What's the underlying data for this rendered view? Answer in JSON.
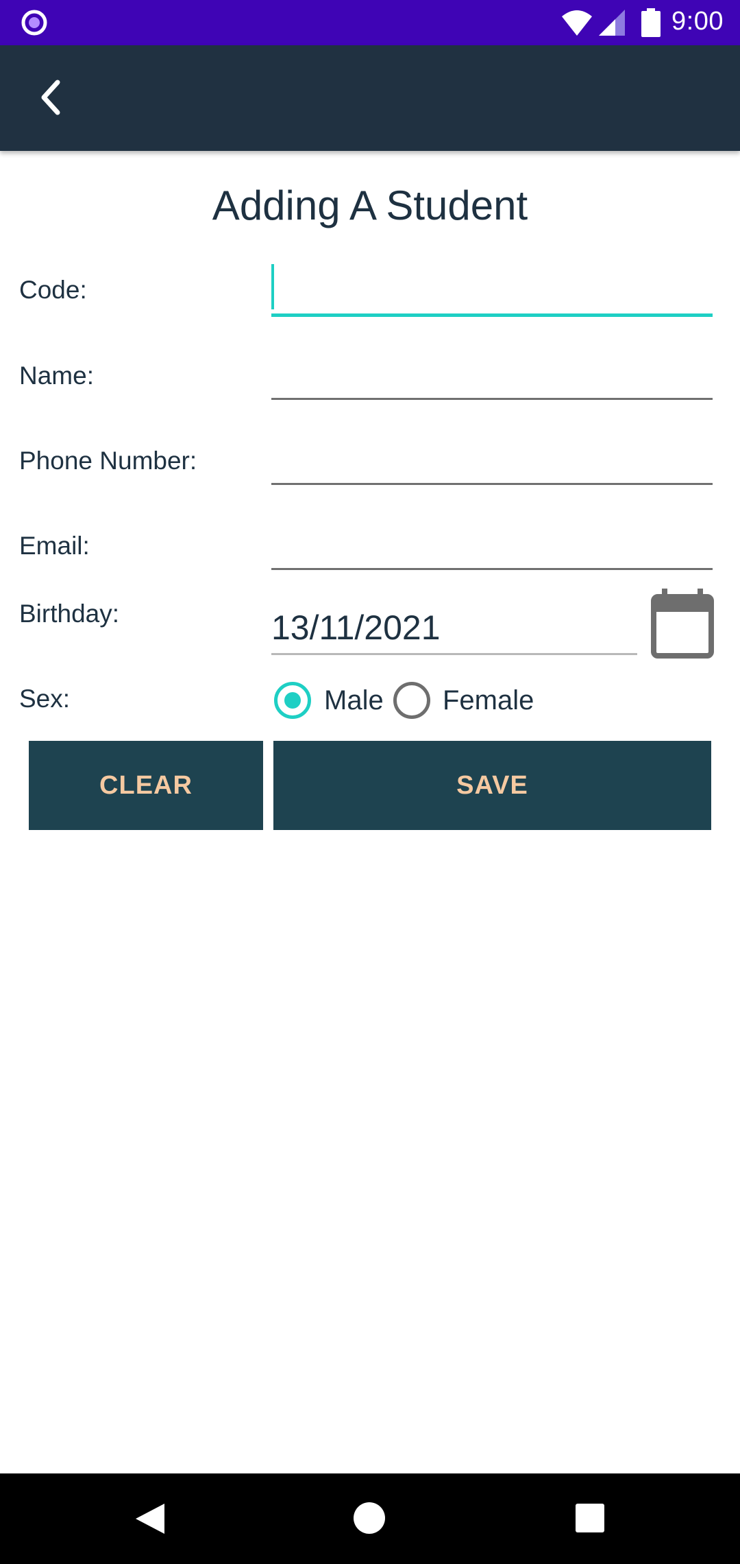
{
  "status_bar": {
    "time": "9:00",
    "icons": [
      "notification-dot-icon",
      "wifi-icon",
      "signal-icon",
      "battery-icon"
    ]
  },
  "app_bar": {
    "back_icon": "chevron-left-icon"
  },
  "form": {
    "title": "Adding A Student",
    "code": {
      "label": "Code:",
      "value": ""
    },
    "name": {
      "label": "Name:",
      "value": ""
    },
    "phone": {
      "label": "Phone Number:",
      "value": ""
    },
    "email": {
      "label": "Email:",
      "value": ""
    },
    "birthday": {
      "label": "Birthday:",
      "value": "13/11/2021",
      "icon": "calendar-icon"
    },
    "sex": {
      "label": "Sex:",
      "options": [
        {
          "label": "Male",
          "checked": true
        },
        {
          "label": "Female",
          "checked": false
        }
      ]
    },
    "buttons": {
      "clear": "CLEAR",
      "save": "SAVE"
    }
  },
  "colors": {
    "status_bar": "#3f04b5",
    "app_bar": "#203141",
    "accent": "#1ecfc4",
    "button_bg": "#1e4350",
    "button_text": "#f5c9a1"
  }
}
